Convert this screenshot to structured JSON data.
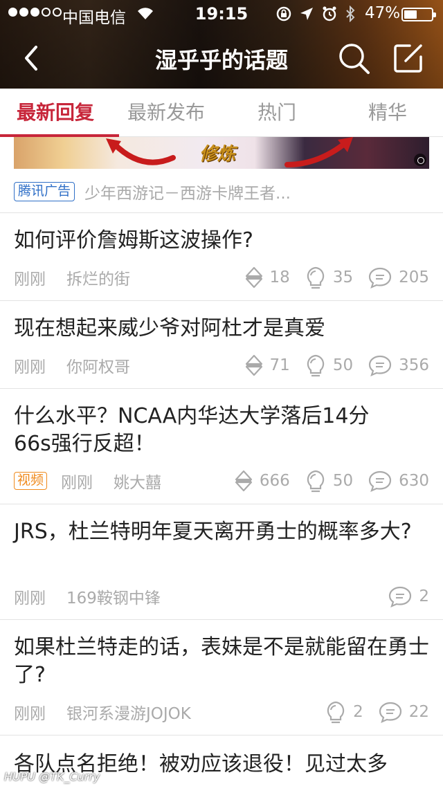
{
  "status_bar": {
    "carrier": "中国电信",
    "time": "19:15",
    "battery": "47%",
    "battery_level": 0.47
  },
  "nav": {
    "title": "湿乎乎的话题"
  },
  "tabs": [
    {
      "label": "最新回复",
      "active": true
    },
    {
      "label": "最新发布",
      "active": false
    },
    {
      "label": "热门",
      "active": false
    },
    {
      "label": "精华",
      "active": false
    }
  ],
  "ad": {
    "banner_word": "修炼",
    "tag": "腾讯广告",
    "text": "少年西游记－西游卡牌王者..."
  },
  "posts": [
    {
      "title": "如何评价詹姆斯这波操作?",
      "time": "刚刚",
      "author": "拆烂的街",
      "votes": "18",
      "lights": "35",
      "replies": "205",
      "video": ""
    },
    {
      "title": "现在想起来威少爷对阿杜才是真爱",
      "time": "刚刚",
      "author": "你阿权哥",
      "votes": "71",
      "lights": "50",
      "replies": "356",
      "video": ""
    },
    {
      "title": "什么水平？NCAA内华达大学落后14分66s强行反超！",
      "time": "刚刚",
      "author": "姚大囍",
      "votes": "666",
      "lights": "50",
      "replies": "630",
      "video": "视频"
    },
    {
      "title": "JRS，杜兰特明年夏天离开勇士的概率多大?",
      "time": "刚刚",
      "author": "169鞍钢中锋",
      "votes": "",
      "lights": "",
      "replies": "2",
      "video": ""
    },
    {
      "title": "如果杜兰特走的话，表妹是不是就能留在勇士了?",
      "time": "刚刚",
      "author": "银河系漫游JOJOK",
      "votes": "",
      "lights": "2",
      "replies": "22",
      "video": ""
    },
    {
      "title": "各队点名拒绝！被劝应该退役！见过太多",
      "time": "",
      "author": "",
      "votes": "",
      "lights": "",
      "replies": "",
      "video": ""
    }
  ],
  "watermark": "HUPU @TK_Curry",
  "colors": {
    "accent": "#c7263a",
    "ad_tag": "#2f6fc7",
    "video_tag": "#f08a1c",
    "muted_text": "#aaaaaa"
  }
}
